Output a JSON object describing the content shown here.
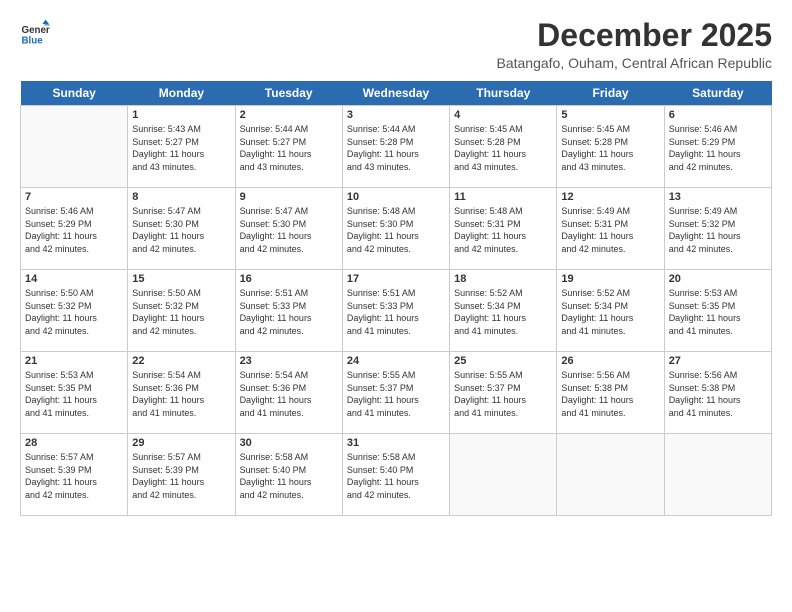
{
  "logo": {
    "line1": "General",
    "line2": "Blue"
  },
  "title": "December 2025",
  "subtitle": "Batangafo, Ouham, Central African Republic",
  "days_of_week": [
    "Sunday",
    "Monday",
    "Tuesday",
    "Wednesday",
    "Thursday",
    "Friday",
    "Saturday"
  ],
  "weeks": [
    [
      {
        "day": "",
        "info": ""
      },
      {
        "day": "1",
        "info": "Sunrise: 5:43 AM\nSunset: 5:27 PM\nDaylight: 11 hours\nand 43 minutes."
      },
      {
        "day": "2",
        "info": "Sunrise: 5:44 AM\nSunset: 5:27 PM\nDaylight: 11 hours\nand 43 minutes."
      },
      {
        "day": "3",
        "info": "Sunrise: 5:44 AM\nSunset: 5:28 PM\nDaylight: 11 hours\nand 43 minutes."
      },
      {
        "day": "4",
        "info": "Sunrise: 5:45 AM\nSunset: 5:28 PM\nDaylight: 11 hours\nand 43 minutes."
      },
      {
        "day": "5",
        "info": "Sunrise: 5:45 AM\nSunset: 5:28 PM\nDaylight: 11 hours\nand 43 minutes."
      },
      {
        "day": "6",
        "info": "Sunrise: 5:46 AM\nSunset: 5:29 PM\nDaylight: 11 hours\nand 42 minutes."
      }
    ],
    [
      {
        "day": "7",
        "info": "Sunrise: 5:46 AM\nSunset: 5:29 PM\nDaylight: 11 hours\nand 42 minutes."
      },
      {
        "day": "8",
        "info": "Sunrise: 5:47 AM\nSunset: 5:30 PM\nDaylight: 11 hours\nand 42 minutes."
      },
      {
        "day": "9",
        "info": "Sunrise: 5:47 AM\nSunset: 5:30 PM\nDaylight: 11 hours\nand 42 minutes."
      },
      {
        "day": "10",
        "info": "Sunrise: 5:48 AM\nSunset: 5:30 PM\nDaylight: 11 hours\nand 42 minutes."
      },
      {
        "day": "11",
        "info": "Sunrise: 5:48 AM\nSunset: 5:31 PM\nDaylight: 11 hours\nand 42 minutes."
      },
      {
        "day": "12",
        "info": "Sunrise: 5:49 AM\nSunset: 5:31 PM\nDaylight: 11 hours\nand 42 minutes."
      },
      {
        "day": "13",
        "info": "Sunrise: 5:49 AM\nSunset: 5:32 PM\nDaylight: 11 hours\nand 42 minutes."
      }
    ],
    [
      {
        "day": "14",
        "info": "Sunrise: 5:50 AM\nSunset: 5:32 PM\nDaylight: 11 hours\nand 42 minutes."
      },
      {
        "day": "15",
        "info": "Sunrise: 5:50 AM\nSunset: 5:32 PM\nDaylight: 11 hours\nand 42 minutes."
      },
      {
        "day": "16",
        "info": "Sunrise: 5:51 AM\nSunset: 5:33 PM\nDaylight: 11 hours\nand 42 minutes."
      },
      {
        "day": "17",
        "info": "Sunrise: 5:51 AM\nSunset: 5:33 PM\nDaylight: 11 hours\nand 41 minutes."
      },
      {
        "day": "18",
        "info": "Sunrise: 5:52 AM\nSunset: 5:34 PM\nDaylight: 11 hours\nand 41 minutes."
      },
      {
        "day": "19",
        "info": "Sunrise: 5:52 AM\nSunset: 5:34 PM\nDaylight: 11 hours\nand 41 minutes."
      },
      {
        "day": "20",
        "info": "Sunrise: 5:53 AM\nSunset: 5:35 PM\nDaylight: 11 hours\nand 41 minutes."
      }
    ],
    [
      {
        "day": "21",
        "info": "Sunrise: 5:53 AM\nSunset: 5:35 PM\nDaylight: 11 hours\nand 41 minutes."
      },
      {
        "day": "22",
        "info": "Sunrise: 5:54 AM\nSunset: 5:36 PM\nDaylight: 11 hours\nand 41 minutes."
      },
      {
        "day": "23",
        "info": "Sunrise: 5:54 AM\nSunset: 5:36 PM\nDaylight: 11 hours\nand 41 minutes."
      },
      {
        "day": "24",
        "info": "Sunrise: 5:55 AM\nSunset: 5:37 PM\nDaylight: 11 hours\nand 41 minutes."
      },
      {
        "day": "25",
        "info": "Sunrise: 5:55 AM\nSunset: 5:37 PM\nDaylight: 11 hours\nand 41 minutes."
      },
      {
        "day": "26",
        "info": "Sunrise: 5:56 AM\nSunset: 5:38 PM\nDaylight: 11 hours\nand 41 minutes."
      },
      {
        "day": "27",
        "info": "Sunrise: 5:56 AM\nSunset: 5:38 PM\nDaylight: 11 hours\nand 41 minutes."
      }
    ],
    [
      {
        "day": "28",
        "info": "Sunrise: 5:57 AM\nSunset: 5:39 PM\nDaylight: 11 hours\nand 42 minutes."
      },
      {
        "day": "29",
        "info": "Sunrise: 5:57 AM\nSunset: 5:39 PM\nDaylight: 11 hours\nand 42 minutes."
      },
      {
        "day": "30",
        "info": "Sunrise: 5:58 AM\nSunset: 5:40 PM\nDaylight: 11 hours\nand 42 minutes."
      },
      {
        "day": "31",
        "info": "Sunrise: 5:58 AM\nSunset: 5:40 PM\nDaylight: 11 hours\nand 42 minutes."
      },
      {
        "day": "",
        "info": ""
      },
      {
        "day": "",
        "info": ""
      },
      {
        "day": "",
        "info": ""
      }
    ]
  ]
}
